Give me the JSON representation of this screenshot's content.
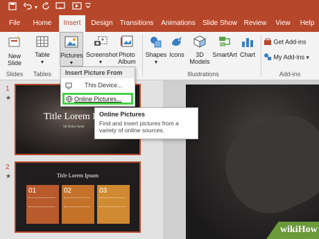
{
  "ribbon_tabs": [
    {
      "label": "File",
      "active": false
    },
    {
      "label": "Home",
      "active": false
    },
    {
      "label": "Insert",
      "active": true
    },
    {
      "label": "Design",
      "active": false
    },
    {
      "label": "Transitions",
      "active": false
    },
    {
      "label": "Animations",
      "active": false
    },
    {
      "label": "Slide Show",
      "active": false
    },
    {
      "label": "Review",
      "active": false
    },
    {
      "label": "View",
      "active": false
    },
    {
      "label": "Help",
      "active": false
    }
  ],
  "ribbon": {
    "new_slide": "New\nSlide",
    "table": "Table",
    "pictures": "Pictures",
    "screenshot": "Screenshot",
    "photo_album": "Photo\nAlbum",
    "shapes": "Shapes",
    "icons": "Icons",
    "models_3d": "3D\nModels",
    "smartart": "SmartArt",
    "chart": "Chart",
    "get_addins": "Get Add-ins",
    "my_addins": "My Add-ins",
    "group_slides": "Slides",
    "group_tables": "Tables",
    "group_illustrations": "Illustrations",
    "group_addins": "Add-ins"
  },
  "dropdown": {
    "header": "Insert Picture From",
    "this_device": "This Device...",
    "online_pictures": "Online Pictures..."
  },
  "tooltip": {
    "title": "Online Pictures",
    "desc": "Find and insert pictures from a variety of online sources."
  },
  "slides": {
    "n1": "1",
    "n2": "2",
    "star": "★",
    "s1_title": "Title Lorem I",
    "s1_sub": "Sit Dolor Amet",
    "s2_title": "Title Lorem Ipsum",
    "boxes": [
      {
        "num": "01",
        "color": "#b85a2c"
      },
      {
        "num": "02",
        "color": "#c4722a"
      },
      {
        "num": "03",
        "color": "#cf8a32"
      }
    ]
  },
  "watermark": "wikiHow",
  "colors": {
    "accent": "#b7472a",
    "highlight": "#47d147"
  }
}
